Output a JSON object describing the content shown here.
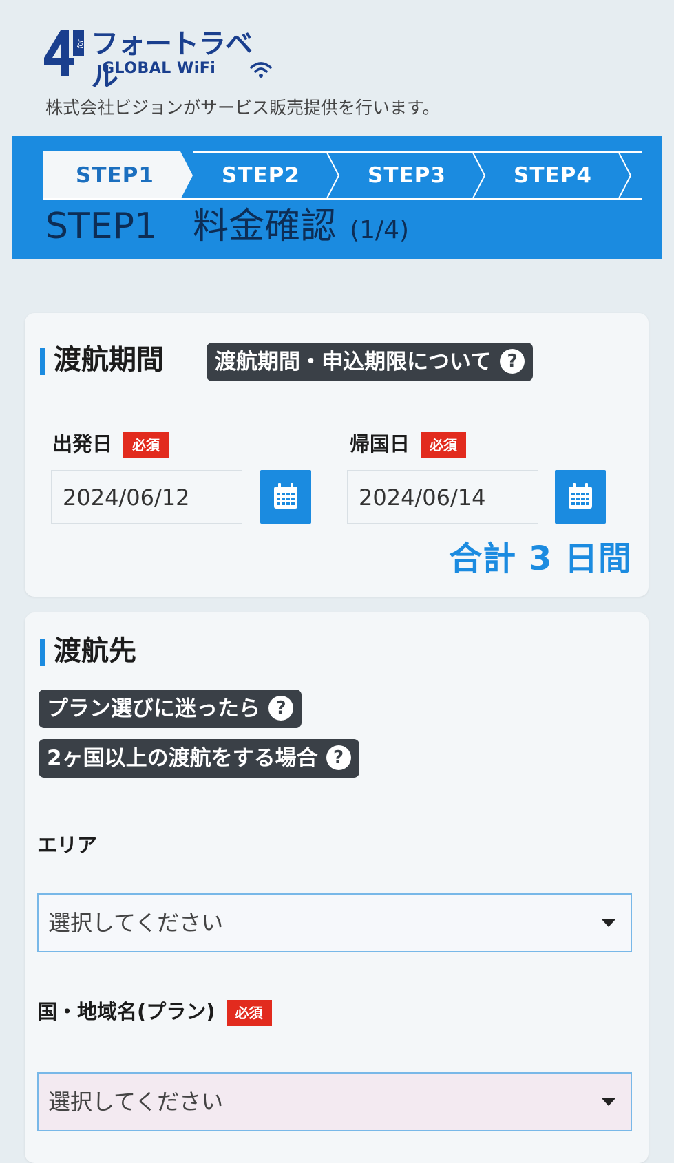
{
  "header": {
    "logo_mark": "4",
    "logo_mark_small": "for",
    "logo_jp": "フォートラベル",
    "logo_en": "GLOBAL WiFi",
    "provider_text": "株式会社ビジョンがサービス販売提供を行います。"
  },
  "steps": {
    "items": [
      {
        "label": "STEP1",
        "active": true
      },
      {
        "label": "STEP2",
        "active": false
      },
      {
        "label": "STEP3",
        "active": false
      },
      {
        "label": "STEP4",
        "active": false
      }
    ],
    "current_title": "STEP1　料金確認",
    "current_fraction": "(1/4)"
  },
  "travel_period": {
    "title": "渡航期間",
    "help_label": "渡航期間・申込期限について",
    "help_icon": "?",
    "departure_label": "出発日",
    "return_label": "帰国日",
    "required_badge": "必須",
    "departure_value": "2024/06/12",
    "return_value": "2024/06/14",
    "total_text": "合計 3 日間"
  },
  "destination": {
    "title": "渡航先",
    "help_plan": "プラン選びに迷ったら",
    "help_multi": "2ヶ国以上の渡航をする場合",
    "help_icon": "?",
    "area_label": "エリア",
    "area_value": "選択してください",
    "country_label": "国・地域名(プラン)",
    "required_badge": "必須",
    "country_value": "選択してください"
  },
  "colors": {
    "accent": "#1b8be0",
    "required": "#e22b1e",
    "pill": "#3a4047",
    "brand": "#1a3f8e"
  }
}
